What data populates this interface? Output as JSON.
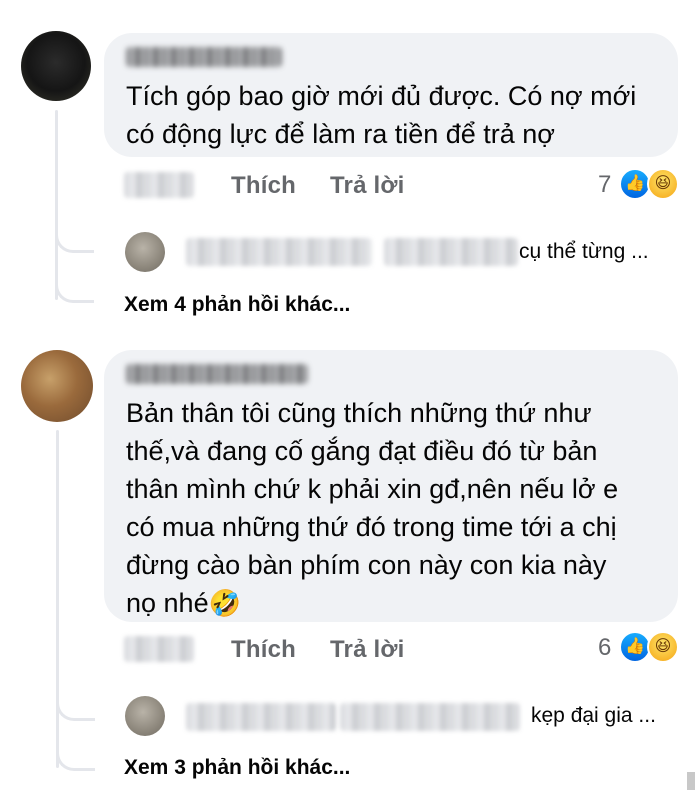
{
  "comments": [
    {
      "author_name": "",
      "text": "Tích góp bao giờ mới đủ được. Có nợ mới\ncó động lực để làm ra tiền để trả nợ",
      "like_label": "Thích",
      "reply_label": "Trả lời",
      "reaction_count": "7",
      "reactions": [
        "like-icon",
        "haha-icon"
      ],
      "reply_preview": "cụ thể từng ...",
      "more_replies": "Xem 4 phản hồi khác..."
    },
    {
      "author_name": "",
      "text": "Bản thân tôi cũng thích những thứ như\nthế,và đang cố gắng đạt điều đó từ bản\nthân mình chứ k phải xin gđ,nên nếu lở e\ncó mua những thứ đó trong time tới a chị\nđừng cào bàn phím con này con kia này\nnọ nhé",
      "emoji": "🤣",
      "like_label": "Thích",
      "reply_label": "Trả lời",
      "reaction_count": "6",
      "reactions": [
        "like-icon",
        "haha-icon"
      ],
      "reply_preview": "kẹp đại gia ...",
      "more_replies": "Xem 3 phản hồi khác..."
    }
  ],
  "colors": {
    "bubble": "#f0f2f5",
    "secondary_text": "#65676b",
    "like_blue": "#1877f2",
    "haha_yellow": "#f7b125"
  }
}
